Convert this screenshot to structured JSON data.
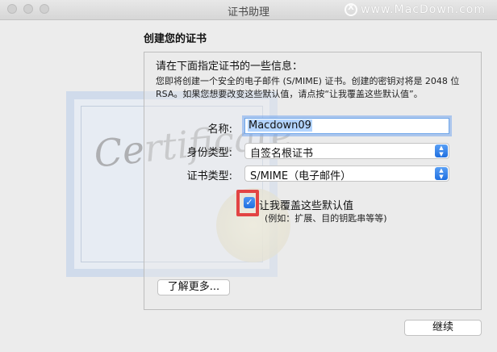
{
  "window": {
    "title": "证书助理"
  },
  "watermark": {
    "text": "www.MacDown.com",
    "logo": "macdown-x-logo"
  },
  "page": {
    "heading": "创建您的证书"
  },
  "intro": {
    "line": "请在下面指定证书的一些信息：",
    "desc_line1": "您即将创建一个安全的电子邮件 (S/MIME) 证书。创建的密钥对将是 2048 位",
    "desc_line2": "RSA。如果您想要改变这些默认值，请点按“让我覆盖这些默认值”。"
  },
  "form": {
    "name_label": "名称:",
    "name_value": "Macdown09",
    "identity_label": "身份类型:",
    "identity_value": "自签名根证书",
    "cert_type_label": "证书类型:",
    "cert_type_value": "S/MIME（电子邮件）",
    "override_checked": true,
    "override_label": "让我覆盖这些默认值",
    "override_sub": "(例如：扩展、目的钥匙串等等)"
  },
  "buttons": {
    "learn_more": "了解更多...",
    "continue": "继续"
  },
  "art": {
    "certificate_script": "Certificate"
  },
  "colors": {
    "accent": "#1f6fe0",
    "highlight": "#e24444",
    "focus_ring": "#76a7ee"
  }
}
